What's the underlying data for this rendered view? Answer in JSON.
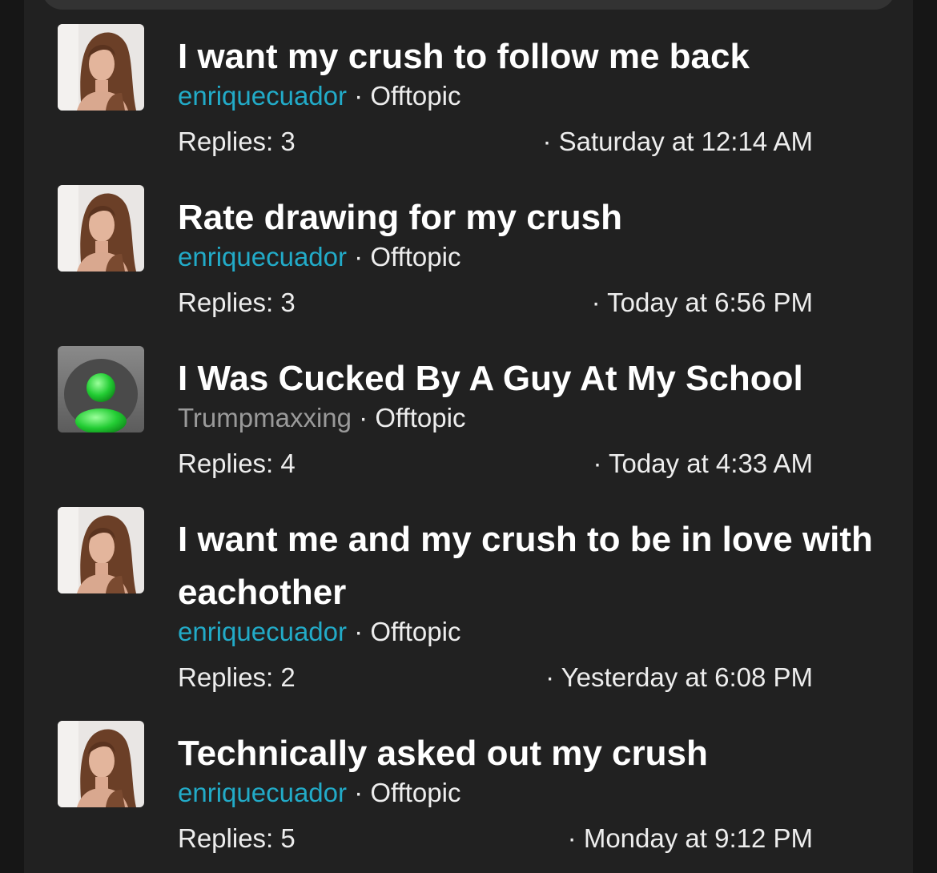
{
  "threads": [
    {
      "title": "I want my crush to follow me back",
      "author": "enriquecuador",
      "separator": "·",
      "forum": "Offtopic",
      "replies": "Replies: 3",
      "date": "· Saturday at 12:14 AM",
      "avatar": "photo-avatar"
    },
    {
      "title": "Rate drawing for my crush",
      "author": "enriquecuador",
      "separator": "·",
      "forum": "Offtopic",
      "replies": "Replies: 3",
      "date": "· Today at 6:56 PM",
      "avatar": "photo-avatar"
    },
    {
      "title": "I Was Cucked By A Guy At My School",
      "author": "Trumpmaxxing",
      "separator": "·",
      "forum": "Offtopic",
      "replies": "Replies: 4",
      "date": "· Today at 4:33 AM",
      "avatar": "default-user-avatar"
    },
    {
      "title": "I want me and my crush to be in love with eachother",
      "author": "enriquecuador",
      "separator": "·",
      "forum": "Offtopic",
      "replies": "Replies: 2",
      "date": "· Yesterday at 6:08 PM",
      "avatar": "photo-avatar"
    },
    {
      "title": "Technically asked out my crush",
      "author": "enriquecuador",
      "separator": "·",
      "forum": "Offtopic",
      "replies": "Replies: 5",
      "date": "· Monday at 9:12 PM",
      "avatar": "photo-avatar"
    }
  ],
  "colors": {
    "background": "#161616",
    "panel": "#212121",
    "author_link": "#22abc8",
    "author_muted": "#9a9a9a",
    "text": "#ffffff"
  }
}
